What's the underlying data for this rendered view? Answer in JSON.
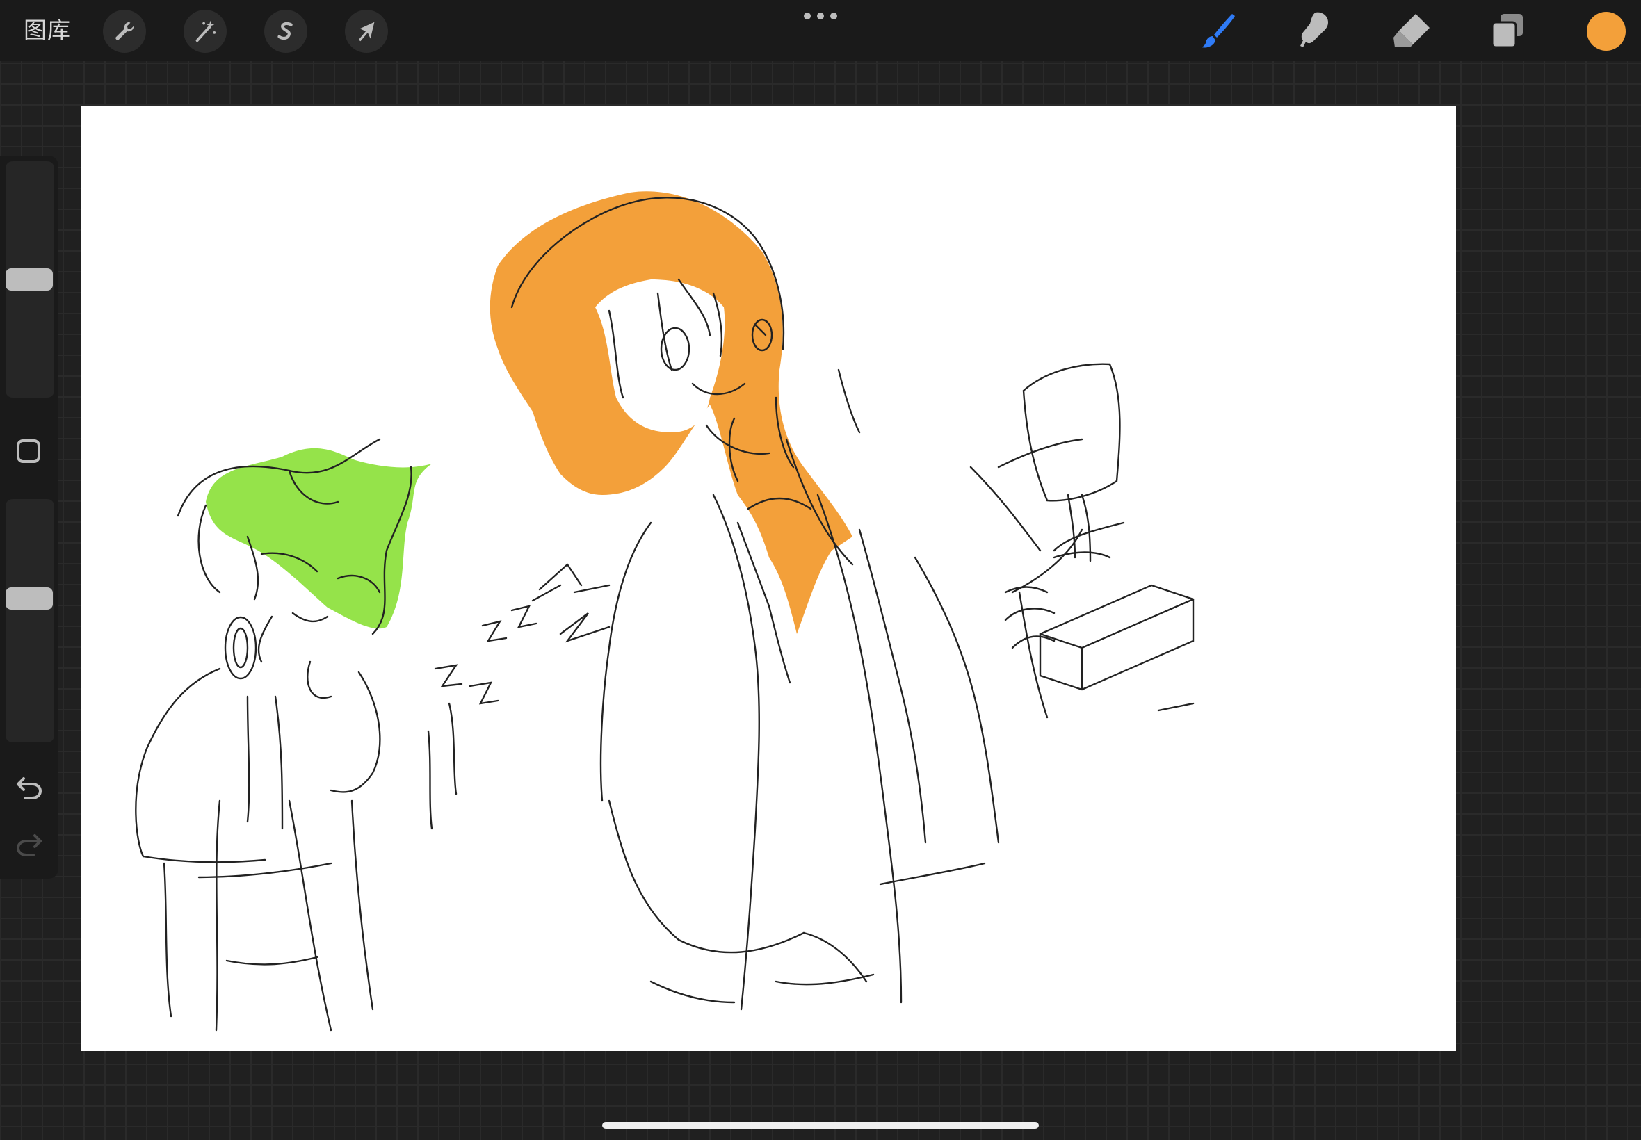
{
  "topbar": {
    "gallery_label": "图库",
    "tools": [
      {
        "name": "actions",
        "icon": "wrench-icon"
      },
      {
        "name": "adjustments",
        "icon": "magic-wand-icon"
      },
      {
        "name": "selection",
        "icon": "selection-s-icon"
      },
      {
        "name": "transform",
        "icon": "arrow-cursor-icon"
      }
    ],
    "more_icon": "ellipsis-icon",
    "right_tools": [
      {
        "name": "brush",
        "icon": "brush-icon",
        "active": true
      },
      {
        "name": "smudge",
        "icon": "smudge-finger-icon",
        "active": false
      },
      {
        "name": "eraser",
        "icon": "eraser-icon",
        "active": false
      },
      {
        "name": "layers",
        "icon": "layers-icon",
        "active": false
      }
    ],
    "current_color": "#f3a03a"
  },
  "sidebar": {
    "brush_size_level": 0.5,
    "opacity_level": 0.6,
    "modify_icon": "square-icon",
    "undo_icon": "undo-icon",
    "redo_icon": "redo-icon"
  },
  "colors": {
    "accent_blue": "#2f7bf6",
    "hair_orange": "#f3a03a",
    "hair_green": "#95e34a"
  }
}
